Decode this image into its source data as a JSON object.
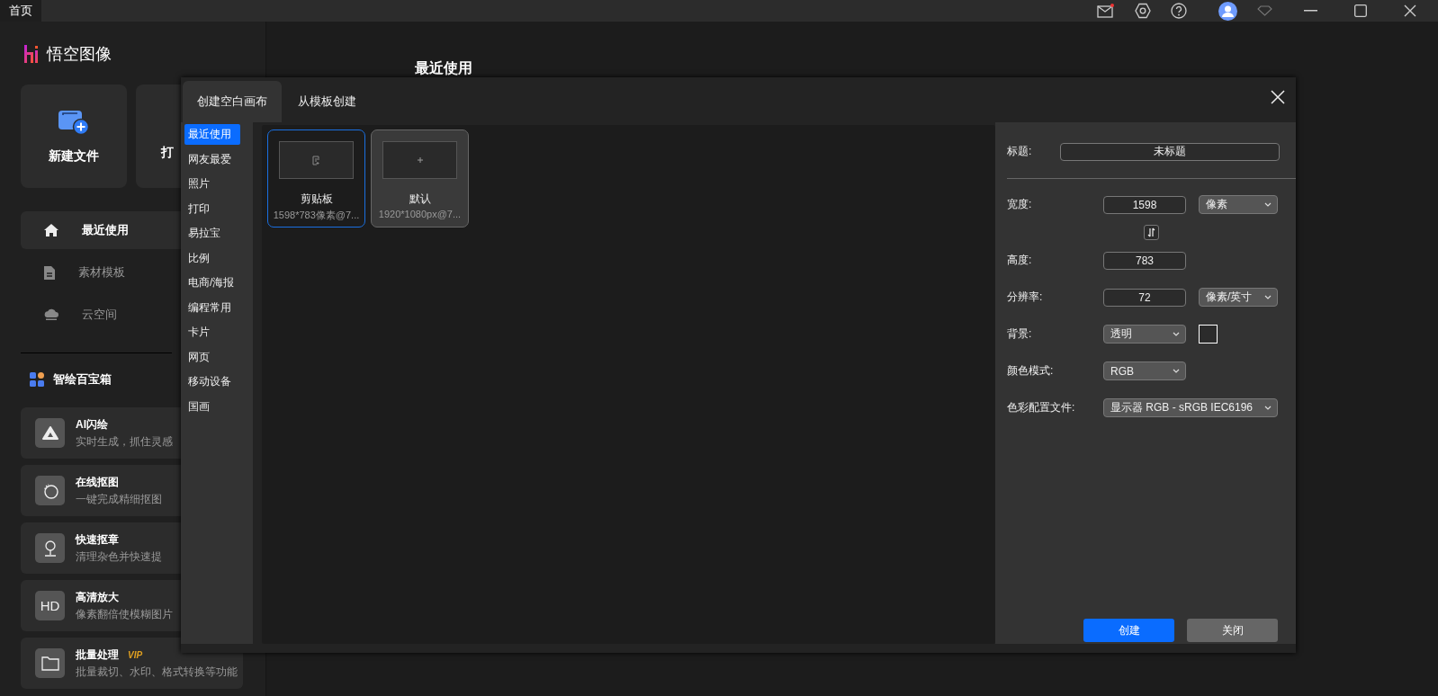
{
  "top_bar": {
    "tab": "首页"
  },
  "app": {
    "name": "悟空图像"
  },
  "quick_actions": [
    {
      "label": "新建文件",
      "kind": "new"
    },
    {
      "label": "打",
      "kind": "open"
    }
  ],
  "nav": [
    {
      "label": "最近使用",
      "kind": "home",
      "selected": true
    },
    {
      "label": "素材模板",
      "kind": "document",
      "selected": false
    },
    {
      "label": "云空间",
      "kind": "cloud",
      "selected": false
    }
  ],
  "toolbox": {
    "title": "智绘百宝箱"
  },
  "tools": [
    {
      "title": "AI闪绘",
      "description": "实时生成，抓住灵感",
      "kind": "ai"
    },
    {
      "title": "在线抠图",
      "description": "一键完成精细抠图",
      "kind": "cutout"
    },
    {
      "title": "快速抠章",
      "description": "清理杂色并快速提",
      "kind": "stamp"
    },
    {
      "title": "高清放大",
      "description": "像素翻倍使模糊图片",
      "kind": "text",
      "icon_text": "HD"
    },
    {
      "title": "批量处理",
      "description": "批量裁切、水印、格式转换等功能",
      "kind": "folder",
      "badge": "VIP"
    }
  ],
  "main": {
    "heading": "最近使用"
  },
  "dialog": {
    "tabs": [
      {
        "label": "创建空白画布",
        "selected": true
      },
      {
        "label": "从模板创建",
        "selected": false
      }
    ],
    "categories": [
      {
        "label": "最近使用",
        "selected": true
      },
      {
        "label": "网友最爱",
        "selected": false
      },
      {
        "label": "照片",
        "selected": false
      },
      {
        "label": "打印",
        "selected": false
      },
      {
        "label": "易拉宝",
        "selected": false
      },
      {
        "label": "比例",
        "selected": false
      },
      {
        "label": "电商/海报",
        "selected": false
      },
      {
        "label": "编程常用",
        "selected": false
      },
      {
        "label": "卡片",
        "selected": false
      },
      {
        "label": "网页",
        "selected": false
      },
      {
        "label": "移动设备",
        "selected": false
      },
      {
        "label": "国画",
        "selected": false
      }
    ],
    "presets": [
      {
        "name": "剪贴板",
        "size": "1598*783像素@7...",
        "kind": "clipboard",
        "selected": true
      },
      {
        "name": "默认",
        "size": "1920*1080px@7...",
        "kind": "blank",
        "selected": false
      }
    ],
    "form": {
      "title": {
        "label": "标题:",
        "value": "未标题"
      },
      "width": {
        "label": "宽度:",
        "value": "1598",
        "unit": "像素"
      },
      "height": {
        "label": "高度:",
        "value": "783"
      },
      "resolution": {
        "label": "分辨率:",
        "value": "72",
        "unit": "像素/英寸"
      },
      "background": {
        "label": "背景:",
        "value": "透明"
      },
      "color_mode": {
        "label": "颜色模式:",
        "value": "RGB"
      },
      "color_profile": {
        "label": "色彩配置文件:",
        "value": "显示器 RGB - sRGB IEC6196"
      }
    },
    "buttons": [
      {
        "label": "创建",
        "kind": "primary"
      },
      {
        "label": "关闭",
        "kind": "secondary"
      }
    ]
  }
}
